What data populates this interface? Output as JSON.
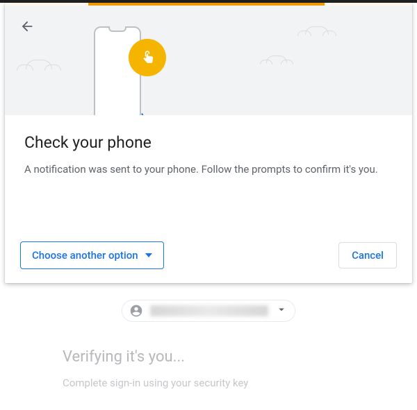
{
  "dialog": {
    "title": "Check your phone",
    "description": "A notification was sent to your phone. Follow the prompts to confirm it's you.",
    "choose_label": "Choose another option",
    "cancel_label": "Cancel"
  },
  "background": {
    "heading": "Verifying it's you...",
    "subtext": "Complete sign-in using your security key"
  },
  "colors": {
    "accent_blue": "#1a73e8",
    "accent_amber": "#f29900",
    "hero_bg": "#f1f3f4",
    "text_primary": "#202124",
    "text_secondary": "#5f6368"
  }
}
